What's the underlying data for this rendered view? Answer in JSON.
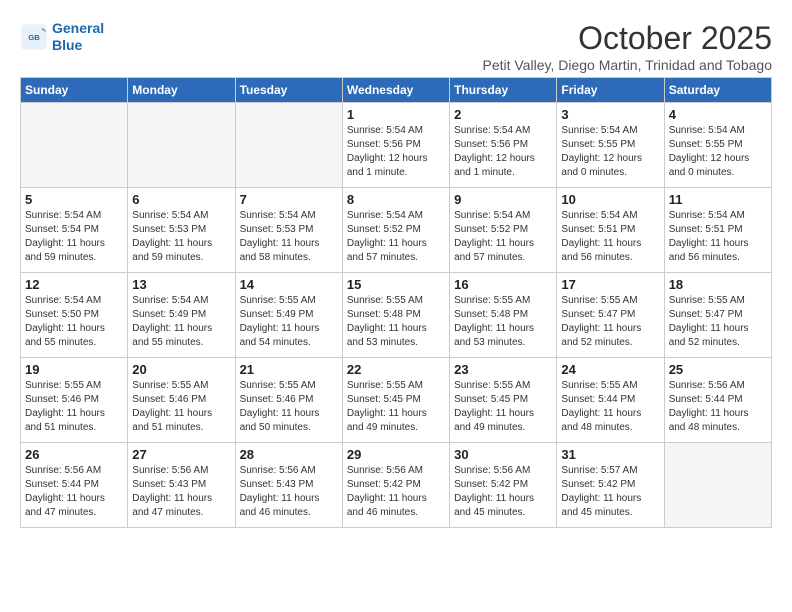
{
  "header": {
    "logo_line1": "General",
    "logo_line2": "Blue",
    "month": "October 2025",
    "location": "Petit Valley, Diego Martin, Trinidad and Tobago"
  },
  "weekdays": [
    "Sunday",
    "Monday",
    "Tuesday",
    "Wednesday",
    "Thursday",
    "Friday",
    "Saturday"
  ],
  "weeks": [
    [
      {
        "day": "",
        "info": ""
      },
      {
        "day": "",
        "info": ""
      },
      {
        "day": "",
        "info": ""
      },
      {
        "day": "1",
        "info": "Sunrise: 5:54 AM\nSunset: 5:56 PM\nDaylight: 12 hours\nand 1 minute."
      },
      {
        "day": "2",
        "info": "Sunrise: 5:54 AM\nSunset: 5:56 PM\nDaylight: 12 hours\nand 1 minute."
      },
      {
        "day": "3",
        "info": "Sunrise: 5:54 AM\nSunset: 5:55 PM\nDaylight: 12 hours\nand 0 minutes."
      },
      {
        "day": "4",
        "info": "Sunrise: 5:54 AM\nSunset: 5:55 PM\nDaylight: 12 hours\nand 0 minutes."
      }
    ],
    [
      {
        "day": "5",
        "info": "Sunrise: 5:54 AM\nSunset: 5:54 PM\nDaylight: 11 hours\nand 59 minutes."
      },
      {
        "day": "6",
        "info": "Sunrise: 5:54 AM\nSunset: 5:53 PM\nDaylight: 11 hours\nand 59 minutes."
      },
      {
        "day": "7",
        "info": "Sunrise: 5:54 AM\nSunset: 5:53 PM\nDaylight: 11 hours\nand 58 minutes."
      },
      {
        "day": "8",
        "info": "Sunrise: 5:54 AM\nSunset: 5:52 PM\nDaylight: 11 hours\nand 57 minutes."
      },
      {
        "day": "9",
        "info": "Sunrise: 5:54 AM\nSunset: 5:52 PM\nDaylight: 11 hours\nand 57 minutes."
      },
      {
        "day": "10",
        "info": "Sunrise: 5:54 AM\nSunset: 5:51 PM\nDaylight: 11 hours\nand 56 minutes."
      },
      {
        "day": "11",
        "info": "Sunrise: 5:54 AM\nSunset: 5:51 PM\nDaylight: 11 hours\nand 56 minutes."
      }
    ],
    [
      {
        "day": "12",
        "info": "Sunrise: 5:54 AM\nSunset: 5:50 PM\nDaylight: 11 hours\nand 55 minutes."
      },
      {
        "day": "13",
        "info": "Sunrise: 5:54 AM\nSunset: 5:49 PM\nDaylight: 11 hours\nand 55 minutes."
      },
      {
        "day": "14",
        "info": "Sunrise: 5:55 AM\nSunset: 5:49 PM\nDaylight: 11 hours\nand 54 minutes."
      },
      {
        "day": "15",
        "info": "Sunrise: 5:55 AM\nSunset: 5:48 PM\nDaylight: 11 hours\nand 53 minutes."
      },
      {
        "day": "16",
        "info": "Sunrise: 5:55 AM\nSunset: 5:48 PM\nDaylight: 11 hours\nand 53 minutes."
      },
      {
        "day": "17",
        "info": "Sunrise: 5:55 AM\nSunset: 5:47 PM\nDaylight: 11 hours\nand 52 minutes."
      },
      {
        "day": "18",
        "info": "Sunrise: 5:55 AM\nSunset: 5:47 PM\nDaylight: 11 hours\nand 52 minutes."
      }
    ],
    [
      {
        "day": "19",
        "info": "Sunrise: 5:55 AM\nSunset: 5:46 PM\nDaylight: 11 hours\nand 51 minutes."
      },
      {
        "day": "20",
        "info": "Sunrise: 5:55 AM\nSunset: 5:46 PM\nDaylight: 11 hours\nand 51 minutes."
      },
      {
        "day": "21",
        "info": "Sunrise: 5:55 AM\nSunset: 5:46 PM\nDaylight: 11 hours\nand 50 minutes."
      },
      {
        "day": "22",
        "info": "Sunrise: 5:55 AM\nSunset: 5:45 PM\nDaylight: 11 hours\nand 49 minutes."
      },
      {
        "day": "23",
        "info": "Sunrise: 5:55 AM\nSunset: 5:45 PM\nDaylight: 11 hours\nand 49 minutes."
      },
      {
        "day": "24",
        "info": "Sunrise: 5:55 AM\nSunset: 5:44 PM\nDaylight: 11 hours\nand 48 minutes."
      },
      {
        "day": "25",
        "info": "Sunrise: 5:56 AM\nSunset: 5:44 PM\nDaylight: 11 hours\nand 48 minutes."
      }
    ],
    [
      {
        "day": "26",
        "info": "Sunrise: 5:56 AM\nSunset: 5:44 PM\nDaylight: 11 hours\nand 47 minutes."
      },
      {
        "day": "27",
        "info": "Sunrise: 5:56 AM\nSunset: 5:43 PM\nDaylight: 11 hours\nand 47 minutes."
      },
      {
        "day": "28",
        "info": "Sunrise: 5:56 AM\nSunset: 5:43 PM\nDaylight: 11 hours\nand 46 minutes."
      },
      {
        "day": "29",
        "info": "Sunrise: 5:56 AM\nSunset: 5:42 PM\nDaylight: 11 hours\nand 46 minutes."
      },
      {
        "day": "30",
        "info": "Sunrise: 5:56 AM\nSunset: 5:42 PM\nDaylight: 11 hours\nand 45 minutes."
      },
      {
        "day": "31",
        "info": "Sunrise: 5:57 AM\nSunset: 5:42 PM\nDaylight: 11 hours\nand 45 minutes."
      },
      {
        "day": "",
        "info": ""
      }
    ]
  ]
}
